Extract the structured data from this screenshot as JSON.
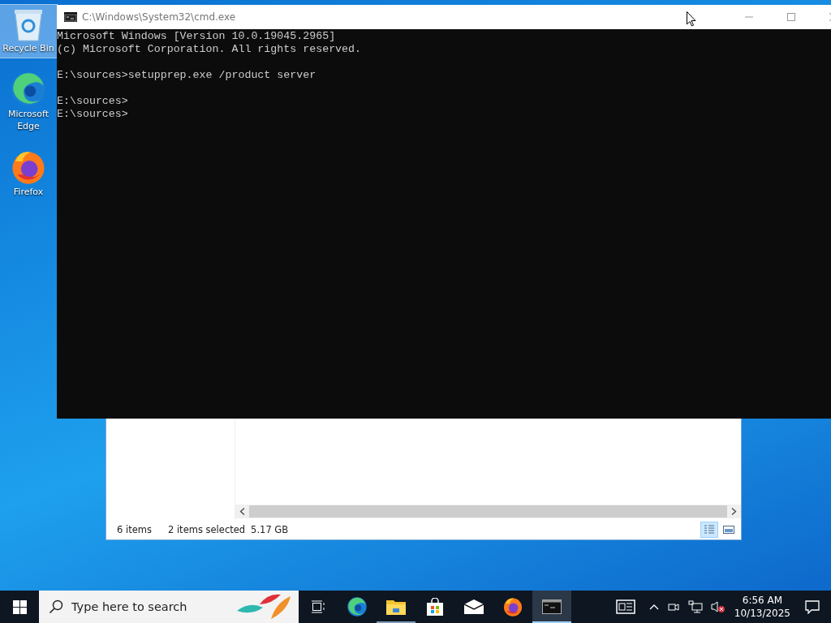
{
  "desktop_icons": [
    {
      "kind": "recycle-bin",
      "label": "Recycle Bin",
      "selected": true
    },
    {
      "kind": "edge",
      "label": "Microsoft Edge",
      "selected": false
    },
    {
      "kind": "firefox",
      "label": "Firefox",
      "selected": false
    }
  ],
  "explorer_window": {
    "status_bar": {
      "item_count": "6 items",
      "selection": "2 items selected",
      "size": "5.17 GB"
    },
    "view_buttons": [
      {
        "kind": "details",
        "selected": true
      },
      {
        "kind": "large-icons",
        "selected": false
      }
    ]
  },
  "cmd_window": {
    "title": "C:\\Windows\\System32\\cmd.exe",
    "blocks": [
      [
        "Microsoft Windows [Version 10.0.19045.2965]",
        "(c) Microsoft Corporation. All rights reserved."
      ],
      [
        "E:\\sources>setupprep.exe /product server"
      ],
      [
        "E:\\sources>",
        "E:\\sources>"
      ]
    ]
  },
  "taskbar": {
    "search": {
      "placeholder": "Type here to search"
    },
    "apps": [
      {
        "kind": "task-view",
        "open": false,
        "active": false
      },
      {
        "kind": "edge",
        "open": false,
        "active": false
      },
      {
        "kind": "file-explorer",
        "open": true,
        "active": false
      },
      {
        "kind": "store",
        "open": false,
        "active": false
      },
      {
        "kind": "mail",
        "open": false,
        "active": false
      },
      {
        "kind": "firefox",
        "open": false,
        "active": false
      },
      {
        "kind": "terminal",
        "open": true,
        "active": true
      }
    ],
    "time": "6:56 AM",
    "date": "10/13/2025"
  }
}
